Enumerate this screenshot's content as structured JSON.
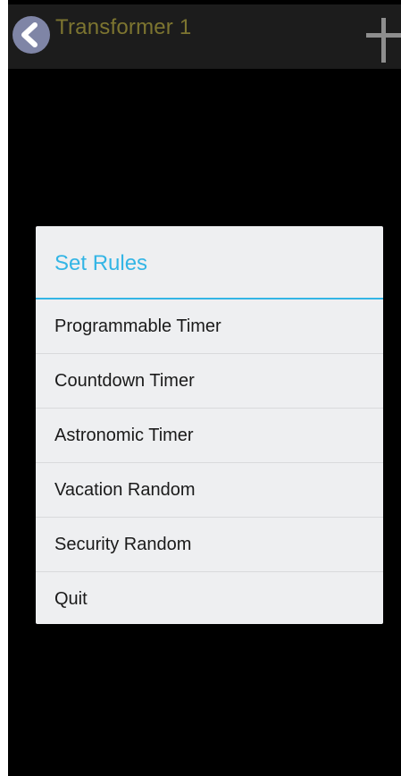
{
  "app_bar": {
    "back_icon": "chevron-left-circle-icon",
    "title": "Transformer 1",
    "add_icon": "plus-icon",
    "title_color": "#7d7530"
  },
  "dialog": {
    "title": "Set Rules",
    "accent_color": "#33b5e5",
    "items": [
      {
        "label": "Programmable Timer"
      },
      {
        "label": "Countdown Timer"
      },
      {
        "label": "Astronomic Timer"
      },
      {
        "label": "Vacation Random"
      },
      {
        "label": "Security Random"
      },
      {
        "label": "Quit"
      }
    ]
  }
}
